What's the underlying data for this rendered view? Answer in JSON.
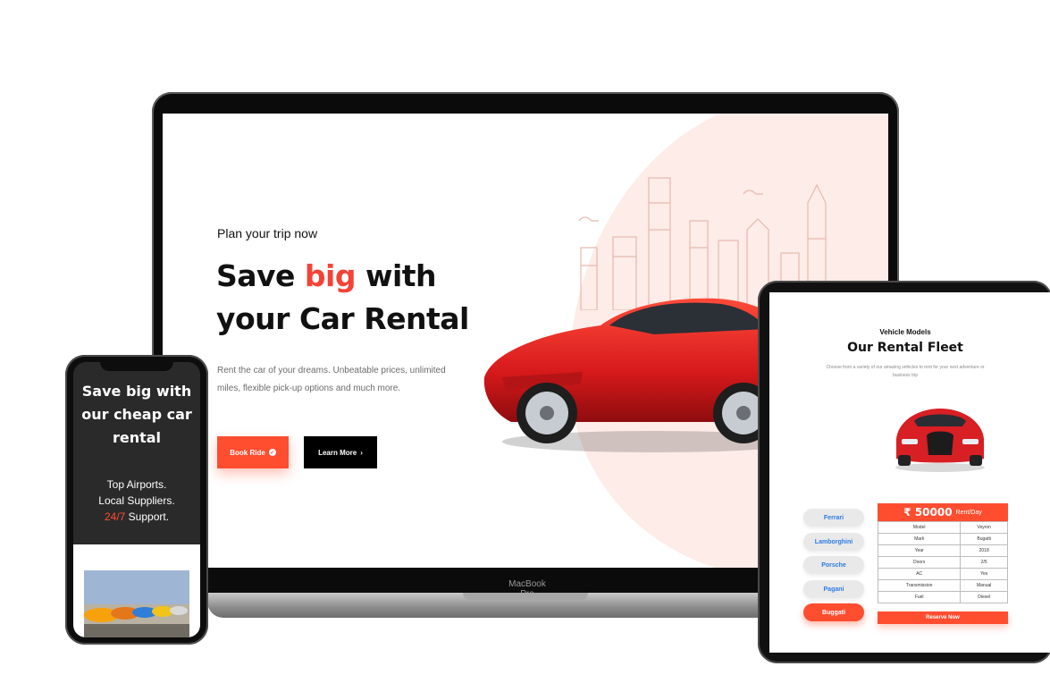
{
  "laptop": {
    "model_label": "MacBook Pro",
    "hero": {
      "eyebrow": "Plan your trip now",
      "title_prefix": "Save ",
      "title_accent": "big",
      "title_suffix": " with your Car Rental",
      "description": "Rent the car of your dreams. Unbeatable prices, unlimited miles, flexible pick-up options and much more.",
      "book_button": "Book Ride",
      "learn_button": "Learn More"
    }
  },
  "phone": {
    "title": "Save big with our cheap car rental",
    "sub_line1": "Top Airports.",
    "sub_line2": "Local Suppliers.",
    "sub_accent": "24/7",
    "sub_line3_suffix": " Support."
  },
  "tablet": {
    "eyebrow": "Vehicle Models",
    "title": "Our Rental Fleet",
    "description": "Choose from a variety of our amazing vehicles to rent for your next adventure or business trip",
    "models": [
      "Ferrari",
      "Lamborghini",
      "Porsche",
      "Pagani",
      "Buggati"
    ],
    "selected_model": "Buggati",
    "price": "₹ 50000",
    "price_suffix": "Rent/Day",
    "specs": [
      {
        "label": "Model",
        "value": "Veyron"
      },
      {
        "label": "Mark",
        "value": "Bugatti"
      },
      {
        "label": "Year",
        "value": "2018"
      },
      {
        "label": "Doors",
        "value": "2/5"
      },
      {
        "label": "AC",
        "value": "Yes"
      },
      {
        "label": "Transmission",
        "value": "Manual"
      },
      {
        "label": "Fuel",
        "value": "Diesel"
      }
    ],
    "reserve_button": "Reserve Now"
  },
  "colors": {
    "accent": "#ff4d30",
    "blob": "#fdece8",
    "dark": "#111111",
    "link_blue": "#2c7be5"
  }
}
